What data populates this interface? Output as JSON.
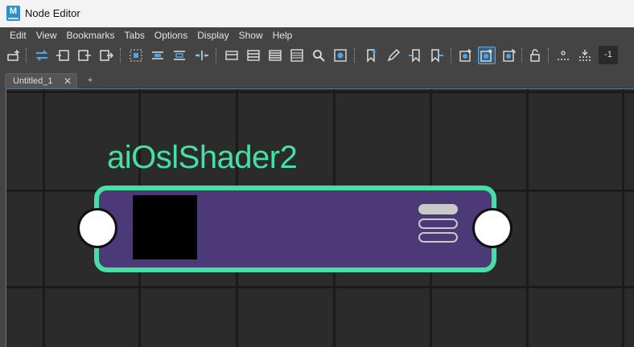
{
  "window": {
    "title": "Node Editor",
    "app_icon_letter": "M",
    "app_icon_color": "#2f8fc6"
  },
  "menu": [
    "Edit",
    "View",
    "Bookmarks",
    "Tabs",
    "Options",
    "Display",
    "Show",
    "Help"
  ],
  "toolbar": {
    "icons": [
      "add-node-icon",
      "graph-io-icon",
      "input-connections-icon",
      "upstream-icon",
      "downstream-icon",
      "frame-all-icon",
      "frame-selection-icon",
      "clear-graph-icon",
      "rearrange-icon",
      "simple-mode-icon",
      "connected-mode-icon",
      "full-mode-icon",
      "custom-mode-icon",
      "search-icon",
      "graph-materials-icon",
      "bookmark-icon",
      "edit-bookmark-icon",
      "prev-bookmark-icon",
      "next-bookmark-icon",
      "swatch-toggle-icon",
      "swatch-active-icon",
      "swatch-refresh-icon",
      "lock-icon",
      "grid-icon",
      "snap-icon"
    ],
    "number_field_value": "-1"
  },
  "tabs": [
    {
      "label": "Untitled_1",
      "close_glyph": "✕"
    }
  ],
  "add_tab_glyph": "+",
  "node": {
    "name": "aiOslShader2",
    "accent_color": "#47e0a4",
    "fill_color": "#4c3a78",
    "swatch_color": "#000000"
  },
  "colors": {
    "graph_background": "#2b2b2b",
    "grid_line": "#1b1b1b",
    "ui_background": "#444444"
  }
}
